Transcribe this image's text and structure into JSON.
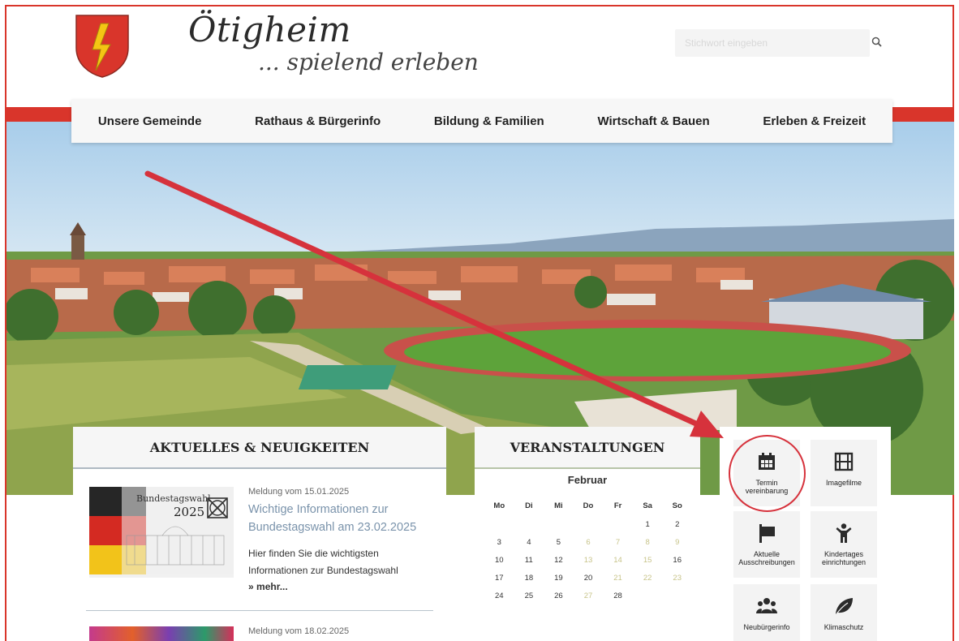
{
  "brand": {
    "title": "Ötigheim",
    "subtitle": "... spielend erleben"
  },
  "search": {
    "placeholder": "Stichwort eingeben"
  },
  "nav": {
    "items": [
      "Unsere Gemeinde",
      "Rathaus & Bürgerinfo",
      "Bildung & Familien",
      "Wirtschaft & Bauen",
      "Erleben & Freizeit"
    ]
  },
  "news": {
    "heading": "AKTUELLES & NEUIGKEITEN",
    "items": [
      {
        "meta": "Meldung vom 15.01.2025",
        "title": "Wichtige Informationen zur Bundestagswahl am 23.02.2025",
        "text": "Hier finden Sie die wichtigsten Informationen zur Bundestagswahl",
        "more": "mehr...",
        "thumb_label": "Bundestagswahl",
        "thumb_year": "2025"
      },
      {
        "meta": "Meldung vom 18.02.2025"
      }
    ]
  },
  "events": {
    "heading": "VERANSTALTUNGEN",
    "month": "Februar",
    "weekdays": [
      "Mo",
      "Di",
      "Mi",
      "Do",
      "Fr",
      "Sa",
      "So"
    ],
    "weeks": [
      [
        "",
        "",
        "",
        "",
        "",
        "1",
        "2"
      ],
      [
        "3",
        "4",
        "5",
        "6",
        "7",
        "8",
        "9"
      ],
      [
        "10",
        "11",
        "12",
        "13",
        "14",
        "15",
        "16"
      ],
      [
        "17",
        "18",
        "19",
        "20",
        "21",
        "22",
        "23"
      ],
      [
        "24",
        "25",
        "26",
        "27",
        "28",
        "",
        ""
      ]
    ],
    "highlighted_days": [
      "6",
      "7",
      "8",
      "9",
      "13",
      "14",
      "15",
      "21",
      "22",
      "23",
      "27"
    ]
  },
  "quicklinks": [
    {
      "label": "Termin vereinbarung",
      "icon": "calendar-icon"
    },
    {
      "label": "Imagefilme",
      "icon": "film-icon"
    },
    {
      "label": "Aktuelle Ausschreibungen",
      "icon": "sign-icon"
    },
    {
      "label": "Kindertages einrichtungen",
      "icon": "child-icon"
    },
    {
      "label": "Neubürgerinfo",
      "icon": "people-icon"
    },
    {
      "label": "Klimaschutz",
      "icon": "leaf-icon"
    }
  ],
  "colors": {
    "accent_red": "#d9352b",
    "link_blue": "#7a93ab"
  }
}
